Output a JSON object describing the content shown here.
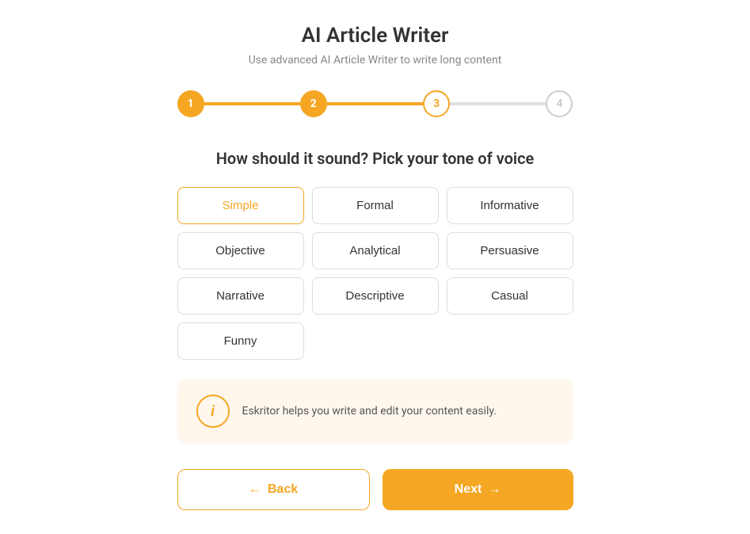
{
  "header": {
    "title": "AI Article Writer",
    "subtitle": "Use advanced AI Article Writer to write long content"
  },
  "steps": [
    {
      "number": "1",
      "state": "completed"
    },
    {
      "number": "2",
      "state": "completed"
    },
    {
      "number": "3",
      "state": "active"
    },
    {
      "number": "4",
      "state": "inactive"
    }
  ],
  "section": {
    "title": "How should it sound? Pick your tone of voice"
  },
  "tones": [
    {
      "label": "Simple",
      "selected": true
    },
    {
      "label": "Formal",
      "selected": false
    },
    {
      "label": "Informative",
      "selected": false
    },
    {
      "label": "Objective",
      "selected": false
    },
    {
      "label": "Analytical",
      "selected": false
    },
    {
      "label": "Persuasive",
      "selected": false
    },
    {
      "label": "Narrative",
      "selected": false
    },
    {
      "label": "Descriptive",
      "selected": false
    },
    {
      "label": "Casual",
      "selected": false
    },
    {
      "label": "Funny",
      "selected": false
    }
  ],
  "info_box": {
    "text": "Eskritor helps you write and edit your content easily."
  },
  "buttons": {
    "back_label": "Back",
    "next_label": "Next"
  },
  "colors": {
    "accent": "#f5a623",
    "inactive": "#cccccc"
  }
}
